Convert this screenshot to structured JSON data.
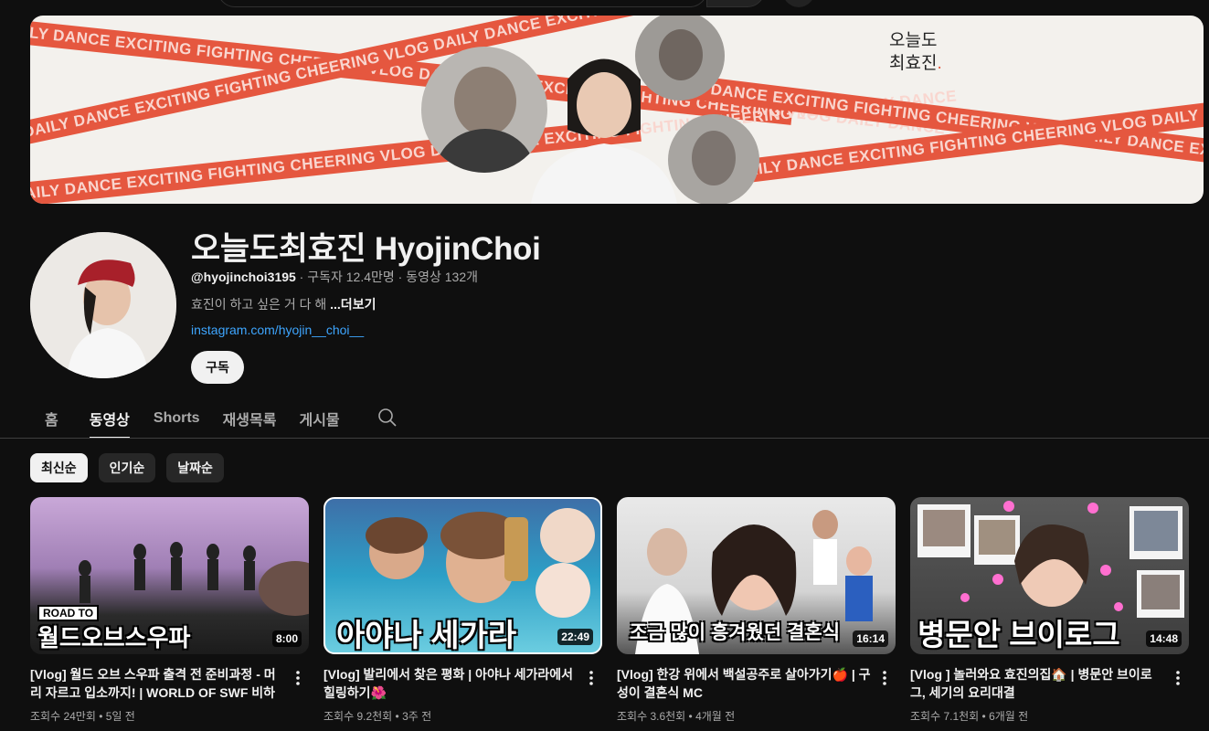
{
  "banner": {
    "tape_text": "DAILY DANCE EXCITING FIGHTING CHEERING VLOG DAILY DANCE EXCITING FIGHTING CHEERING VLOG DAILY DANCE",
    "brand_line1": "오늘도",
    "brand_line2": "최효진",
    "brand_dot": "."
  },
  "channel": {
    "name": "오늘도최효진 HyojinChoi",
    "handle": "@hyojinchoi3195",
    "meta": " · 구독자 12.4만명 · 동영상 132개",
    "description": "효진이 하고 싶은 거 다 해 ",
    "more_label": "...더보기",
    "link": "instagram.com/hyojin__choi__",
    "subscribe_label": "구독"
  },
  "tabs": [
    {
      "label": "홈",
      "active": false
    },
    {
      "label": "동영상",
      "active": true
    },
    {
      "label": "Shorts",
      "active": false
    },
    {
      "label": "재생목록",
      "active": false
    },
    {
      "label": "게시물",
      "active": false
    }
  ],
  "chips": [
    {
      "label": "최신순",
      "active": true
    },
    {
      "label": "인기순",
      "active": false
    },
    {
      "label": "날짜순",
      "active": false
    }
  ],
  "videos": [
    {
      "title": "[Vlog] 월드 오브 스우파 출격 전 준비과정 - 머리 자르고 입소까지! | WORLD OF SWF 비하인드",
      "stats": "조회수 24만회 • 5일 전",
      "duration": "8:00",
      "badge": "ROAD TO",
      "overlay": "월드오브스우파"
    },
    {
      "title": "[Vlog] 발리에서 찾은 평화 | 아야나 세가라에서 힐링하기🌺",
      "stats": "조회수 9.2천회 • 3주 전",
      "duration": "22:49",
      "overlay": "아야나 세가라"
    },
    {
      "title": "[Vlog] 한강 위에서 백설공주로 살아가기🍎 | 구성이 결혼식 MC",
      "stats": "조회수 3.6천회 • 4개월 전",
      "duration": "16:14",
      "overlay": "조금 많이 흥겨웠던 결혼식"
    },
    {
      "title": "[Vlog ] 놀러와요 효진의집🏠 | 병문안 브이로그, 세기의 요리대결",
      "stats": "조회수 7.1천회 • 6개월 전",
      "duration": "14:48",
      "overlay": "병문안 브이로그"
    }
  ]
}
